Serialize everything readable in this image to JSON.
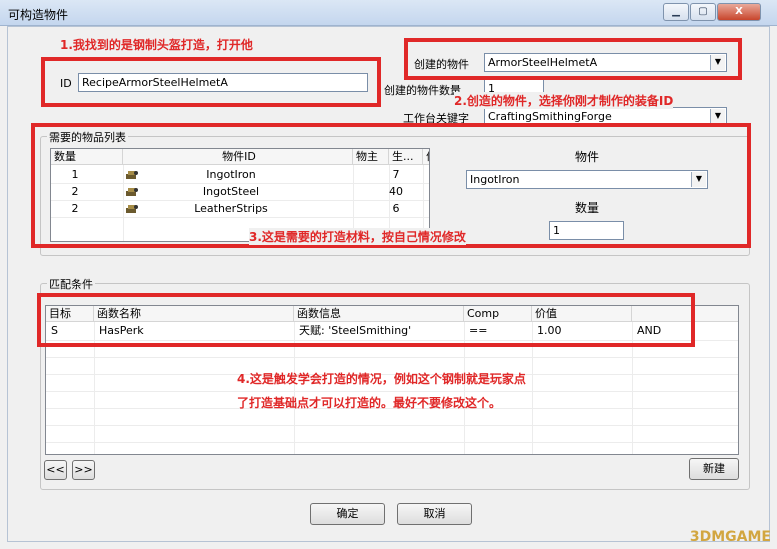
{
  "window": {
    "title": "可构造物件",
    "controls": {
      "minimize": "▁",
      "maximize": "▢",
      "close": "X"
    }
  },
  "fields": {
    "id_label": "ID",
    "id_value": "RecipeArmorSteelHelmetA",
    "created_item_label": "创建的物件",
    "created_item_value": "ArmorSteelHelmetA",
    "created_count_label": "创建的物件数量",
    "created_count_value": "1",
    "workbench_label": "工作台关键字",
    "workbench_value": "CraftingSmithingForge"
  },
  "required_items": {
    "group_title": "需要的物品列表",
    "columns": [
      "数量",
      "物件ID",
      "物主",
      "生...",
      "价值"
    ],
    "rows": [
      {
        "count": "1",
        "item_id": "IngotIron",
        "owner": "",
        "gen": "",
        "value": "7"
      },
      {
        "count": "2",
        "item_id": "IngotSteel",
        "owner": "",
        "gen": "",
        "value": "40"
      },
      {
        "count": "2",
        "item_id": "LeatherStrips",
        "owner": "",
        "gen": "",
        "value": "6"
      }
    ],
    "item_label": "物件",
    "item_value": "IngotIron",
    "quantity_label": "数量",
    "quantity_value": "1"
  },
  "conditions": {
    "group_title": "匹配条件",
    "columns": [
      "目标",
      "函数名称",
      "函数信息",
      "Comp",
      "价值",
      ""
    ],
    "rows": [
      {
        "target": "S",
        "function": "HasPerk",
        "info": "天赋: 'SteelSmithing'",
        "comp": "==",
        "value": "1.00",
        "op": "AND"
      }
    ],
    "prev_button": "<<",
    "next_button": ">>",
    "new_button": "新建"
  },
  "footer": {
    "ok_button": "确定",
    "cancel_button": "取消"
  },
  "annotations": {
    "note1": "1.我找到的是钢制头盔打造，打开他",
    "note2": "2.创造的物件，选择你刚才制作的装备ID",
    "note3": "3.这是需要的打造材料，按自己情况修改",
    "note4_line1": "4.这是触发学会打造的情况，例如这个钢制就是玩家点",
    "note4_line2": "了打造基础点才可以打造的。最好不要修改这个。"
  },
  "watermark": "3DMGAME",
  "colors": {
    "annotation_red": "#e02828",
    "titlebar": "#c4d6ee"
  }
}
